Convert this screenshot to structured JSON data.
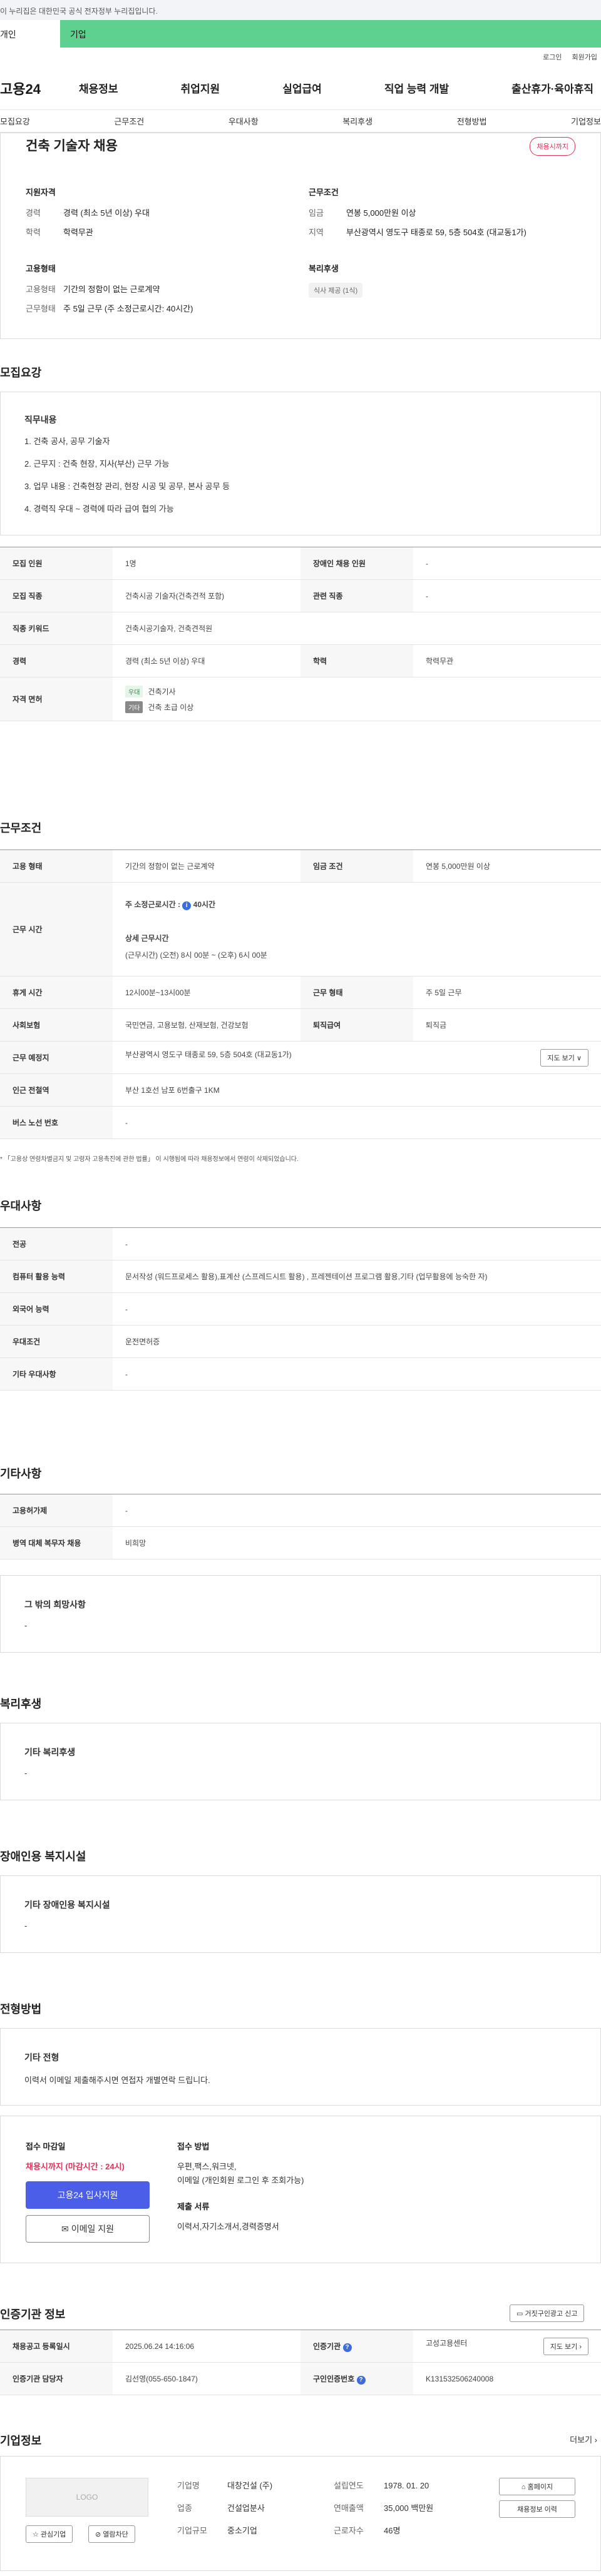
{
  "banner": {
    "text": "이 누리집은 대한민국 공식 전자정부 누리집입니다."
  },
  "usertype": {
    "personal": "개인",
    "company": "기업"
  },
  "util": {
    "login": "로그인",
    "join": "회원가입"
  },
  "gnb": {
    "logo": "고용24",
    "menu": [
      "채용정보",
      "취업지원",
      "실업급여",
      "직업 능력 개발",
      "출산휴가·육아휴직"
    ]
  },
  "tabs": [
    "모집요강",
    "근무조건",
    "우대사항",
    "복리후생",
    "전형방법",
    "기업정보"
  ],
  "hero": {
    "title": "건축 기술자 채용",
    "badge": "채용시까지",
    "qual": {
      "heading": "지원자격",
      "career_k": "경력",
      "career_v": "경력 (최소 5년 이상) 우대",
      "edu_k": "학력",
      "edu_v": "학력무관"
    },
    "cond": {
      "heading": "근무조건",
      "pay_k": "임금",
      "pay_v": "연봉 5,000만원 이상",
      "loc_k": "지역",
      "loc_v": "부산광역시 영도구 태종로 59, 5층 504호 (대교동1가)"
    },
    "emp": {
      "heading": "고용형태",
      "type_k": "고용형태",
      "type_v": "기간의 정함이 없는 근로계약",
      "hours_k": "근무형태",
      "hours_v": "주 5일 근무 (주 소정근로시간: 40시간)"
    },
    "welfare": {
      "heading": "복리후생",
      "pill": "식사 제공 (1식)"
    }
  },
  "recruit": {
    "title": "모집요강",
    "duty_title": "직무내용",
    "duties": [
      "1. 건축 공사, 공무 기술자",
      "2. 근무지 : 건축 현장, 지사(부산) 근무 가능",
      "3. 업무 내용 : 건축현장 관리, 현장 시공 및 공무, 본사 공무 등",
      "4. 경력직 우대 ~ 경력에 따라 급여 협의 가능"
    ],
    "rows": {
      "count_k": "모집 인원",
      "count_v": "1명",
      "disabled_k": "장애인 채용 인원",
      "disabled_v": "-",
      "job_k": "모집 직종",
      "job_v": "건축시공 기술자(건축견적 포함)",
      "rel_k": "관련 직종",
      "rel_v": "-",
      "kw_k": "직종 키워드",
      "kw_v": "건축시공기술자, 건축견적원",
      "career_k": "경력",
      "career_v": "경력 (최소 5년 이상) 우대",
      "edu_k": "학력",
      "edu_v": "학력무관",
      "lic_k": "자격 면허",
      "lic_tag1": "우대",
      "lic1": "건축기사",
      "lic_tag2": "기타",
      "lic2": "건축 초급 이상"
    }
  },
  "work": {
    "title": "근무조건",
    "emp_k": "고용 형태",
    "emp_v": "기간의 정함이 없는 근로계약",
    "pay_k": "임금 조건",
    "pay_v": "연봉 5,000만원 이상",
    "time_k": "근무 시간",
    "time_main": "주 소정근로시간 :",
    "time_hours": "40시간",
    "time_sub": "상세 근무시간",
    "time_detail": "(근무시간) (오전) 8시 00분 ~ (오후) 6시 00분",
    "rest_k": "휴게 시간",
    "rest_v": "12시00분~13시00분",
    "shape_k": "근무 형태",
    "shape_v": "주 5일 근무",
    "ins_k": "사회보험",
    "ins_v": "국민연금, 고용보험, 산재보험, 건강보험",
    "sev_k": "퇴직급여",
    "sev_v": "퇴직금",
    "place_k": "근무 예정지",
    "place_v": "부산광역시 영도구 태종로 59, 5층 504호 (대교동1가)",
    "map_btn": "지도 보기",
    "subway_k": "인근 전철역",
    "subway_v": "부산 1호선 남포 6번출구 1KM",
    "bus_k": "버스 노선 번호",
    "bus_v": "-",
    "note": "* 「고용상 연령차별금지 및 고령자 고용촉진에 관한 법률」 이 시행됨에 따라 채용정보에서 연령이 삭제되었습니다."
  },
  "pref": {
    "title": "우대사항",
    "major_k": "전공",
    "major_v": "-",
    "pc_k": "컴퓨터 활용 능력",
    "pc_v": "문서작성 (워드프로세스 활용),표계산 (스프레드시트 활용) , 프레젠테이션 프로그램 활용,기타 (업무활용에 능숙한 자)",
    "lang_k": "외국어 능력",
    "lang_v": "-",
    "cond_k": "우대조건",
    "cond_v": "운전면허증",
    "etc_k": "기타 우대사항",
    "etc_v": "-"
  },
  "other": {
    "title": "기타사항",
    "ins_k": "고용허가제",
    "ins_v": "-",
    "mil_k": "병역 대체 복무자 채용",
    "mil_v": "비희망",
    "hope_title": "그 밖의 희망사항",
    "hope_v": "-"
  },
  "welfare": {
    "title": "복리후생",
    "box_title": "기타 복리후생",
    "box_v": "-"
  },
  "facility": {
    "title": "장애인용 복지시설",
    "box_title": "기타 장애인용 복지시설",
    "box_v": "-"
  },
  "process": {
    "title": "전형방법",
    "box_title": "기타 전형",
    "box_v": "이력서 이메일 제출해주시면 연접자 개별연락 드립니다."
  },
  "apply": {
    "deadline_title": "접수 마감일",
    "deadline_v": "채용시까지 (마감시간 : 24시)",
    "btn1": "고용24 입사지원",
    "btn2": "이메일 지원",
    "method_title": "접수 방법",
    "method_v1": "우편,팩스,워크넷,",
    "method_v2": "이메일 (개인회원 로그인 후 조회가능)",
    "doc_title": "제출 서류",
    "doc_v": "이력서,자기소개서,경력증명서"
  },
  "cert": {
    "title": "인증기관 정보",
    "report_btn": "거짓구인광고 신고",
    "reg_k": "채용공고 등록일시",
    "reg_v": "2025.06.24 14:16:06",
    "org_k": "인증기관",
    "org_v": "고성고용센터",
    "btn": "지도 보기",
    "mgr_k": "인증기관 담당자",
    "mgr_v": "김선영(055-650-1847)",
    "no_k": "구인인증번호",
    "no_v": "K131532506240008"
  },
  "company": {
    "title": "기업정보",
    "more": "더보기",
    "logo": "LOGO",
    "interest": "관심기업",
    "block": "열람차단",
    "name_k": "기업명",
    "name_v": "대창건설 (주)",
    "ind_k": "업종",
    "ind_v": "건설업분사",
    "size_k": "기업규모",
    "size_v": "중소기업",
    "est_k": "설립연도",
    "est_v": "1978. 01. 20",
    "sales_k": "연매출액",
    "sales_v": "35,000 백만원",
    "emp_k": "근로자수",
    "emp_v": "46명",
    "home_btn": "홈페이지",
    "jobs_btn": "채용정보 이력"
  }
}
